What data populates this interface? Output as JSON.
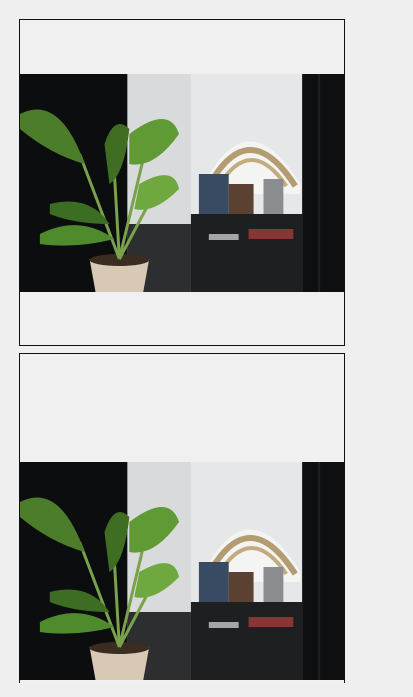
{
  "cards": [
    {
      "image_subject": "boutique-interior-with-bird-of-paradise-plant"
    },
    {
      "image_subject": "boutique-interior-with-bird-of-paradise-plant"
    }
  ]
}
